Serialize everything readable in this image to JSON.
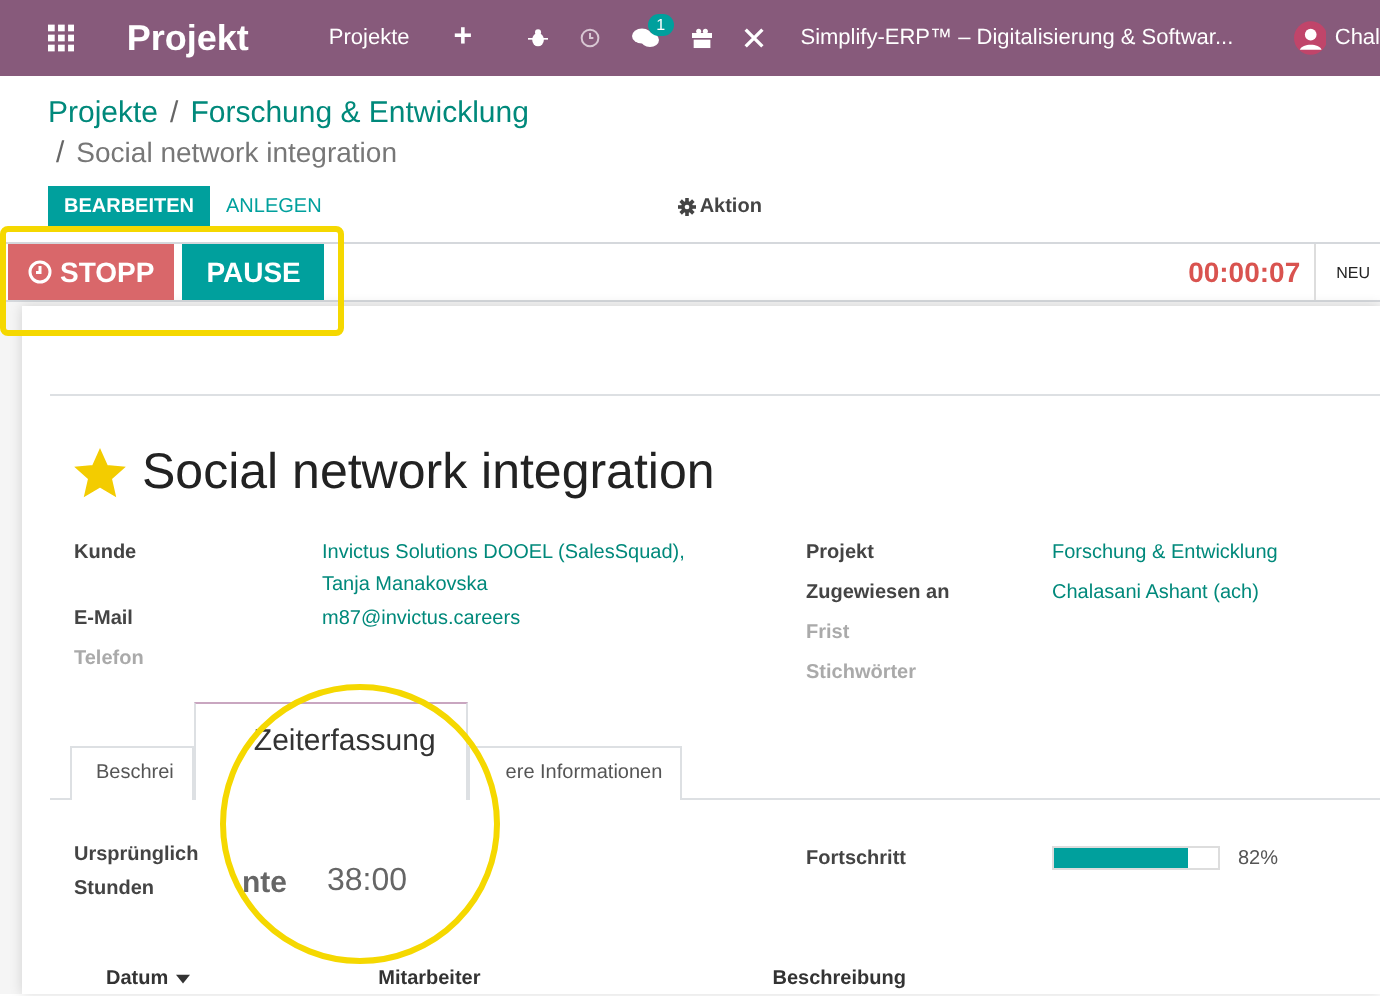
{
  "navbar": {
    "app_title": "Projekt",
    "menu": "Projekte",
    "plus": "+",
    "messages_badge": "1",
    "company": "Simplify-ERP™ – Digitalisierung & Softwar...",
    "user": "Chal"
  },
  "breadcrumb": {
    "items": [
      "Projekte",
      "Forschung & Entwicklung"
    ],
    "separators": [
      "/",
      "/"
    ],
    "current": "Social network integration"
  },
  "control_panel": {
    "buttons": [
      "BEARBEITEN",
      "ANLEGEN"
    ],
    "action": "Aktion"
  },
  "timer": {
    "stop": "STOPP",
    "pause": "PAUSE",
    "time": "00:00:07",
    "stage": "NEU"
  },
  "task": {
    "title": "Social network integration",
    "starred": true
  },
  "fields_left": [
    {
      "label": "Kunde",
      "values": [
        "Invictus Solutions DOOEL (SalesSquad),",
        "Tanja Manakovska"
      ],
      "empty": false
    },
    {
      "label": "E-Mail",
      "values": [
        "m87@invictus.careers"
      ],
      "empty": false
    },
    {
      "label": "Telefon",
      "empty": true
    }
  ],
  "fields_right": [
    {
      "label": "Projekt",
      "values": [
        "Forschung & Entwicklung"
      ],
      "empty": false
    },
    {
      "label": "Zugewiesen an",
      "values": [
        "Chalasani Ashant (ach)"
      ],
      "empty": false
    },
    {
      "label": "Frist",
      "empty": true
    },
    {
      "label": "Stichwörter",
      "empty": true
    }
  ],
  "tabs": [
    {
      "label": "Beschrei",
      "selected": false
    },
    {
      "label": "Zeiterfassung",
      "selected": true
    },
    {
      "label": "ere Informationen",
      "selected": false
    }
  ],
  "timesheet": {
    "planned_label": [
      "Ursprünglich",
      "Stunden"
    ],
    "magnified_label": "nte",
    "planned_value": "38:00",
    "progress_label": "Fortschritt",
    "level": 0.82,
    "reading": "82%"
  },
  "table": {
    "columns": [
      "Datum",
      "Mitarbeiter",
      "Beschreibung"
    ]
  }
}
